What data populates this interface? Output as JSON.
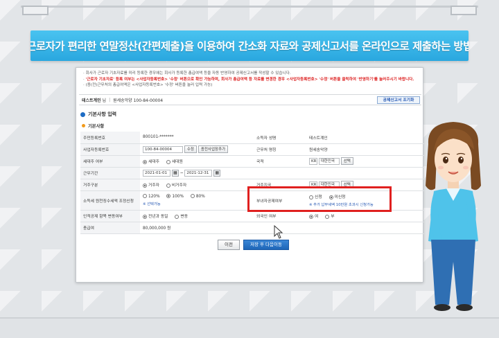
{
  "title": "근로자가 편리한 연말정산(간편제출)을 이용하여 간소화 자료와 공제신고서를 온라인으로 제출하는 방법",
  "notice": {
    "line1": "회사가 근로자 기초자료를 미리 등록한 경우에는 회사가 등록한 총급여액 등을 자동 반영하여 공제신고서를 작성할 수 있습니다.",
    "line2_red": "'근로자 기초자료' 등록 여부는 <사업자등록번호> '수정' 버튼으로 확인 가능하며, 회사가 총급여액 등 자료를 변경한 경우 <사업자등록번호> '수정' 버튼을 클릭하여 '반영하기'를 눌러주시기 바랍니다.",
    "line3": "(종(전)근무처의 총급여액은 <사업자등록번호> '수정' 버튼을 눌러 입력 가능)"
  },
  "company": {
    "name": "테스트계인",
    "suffix": "님",
    "workplace": "원세송악양 100-84-00004",
    "deduction_button": "공제신고서 조기화"
  },
  "section_title": "기본사항 입력",
  "subsection_title": "기본사항",
  "form": {
    "resident_number_label": "주민등록번호",
    "resident_number_value": "800101-*******",
    "income_earner_label": "소득자 성명",
    "income_earner_value": "테스트계인",
    "business_number_label": "사업자등록번호",
    "business_number_value": "100-84-00004",
    "edit_button": "수정",
    "add_former_button": "종전사업장추가",
    "workplace_label": "근무처 명칭",
    "workplace_value": "원세송악양",
    "household_label": "세대주 여부",
    "household_options": [
      "세대주",
      "세대원"
    ],
    "nationality_label": "국적",
    "nationality_code": "KR",
    "nationality_name": "대한민국",
    "select_button": "선택",
    "period_label": "근무기간",
    "period_start": "2021-01-01",
    "period_end": "2021-12-31",
    "period_sep": "~",
    "residence_label": "거주구분",
    "residence_options": [
      "거주자",
      "비거주자"
    ],
    "residence_country_label": "거주지국",
    "residence_country_code": "KR",
    "residence_country_name": "대한민국",
    "tax_rate_label": "소득세 원천징수세액 조정신청",
    "tax_rate_options": [
      "120%",
      "100%",
      "80%"
    ],
    "tax_rate_note": "※ 선택가능",
    "female_head_label": "부녀자공제여부",
    "female_head_options": [
      "신청",
      "미신청"
    ],
    "female_head_note": "※ 추가 납부세액 10만원 초과시 신청가능",
    "personal_deduction_label": "인적공제 항목 변동여부",
    "personal_deduction_options": [
      "전년과 동일",
      "변동"
    ],
    "foreign_label": "외국인 여부",
    "foreign_options": [
      "여",
      "부"
    ],
    "total_pay_label": "총급여",
    "total_pay_value": "80,000,000",
    "total_pay_unit": "원"
  },
  "buttons": {
    "prev": "이전",
    "next": "저장 후 다음이동"
  },
  "colors": {
    "title_bar": "#2aa7df",
    "highlight": "#e0201f",
    "primary_button": "#1e66b8"
  }
}
